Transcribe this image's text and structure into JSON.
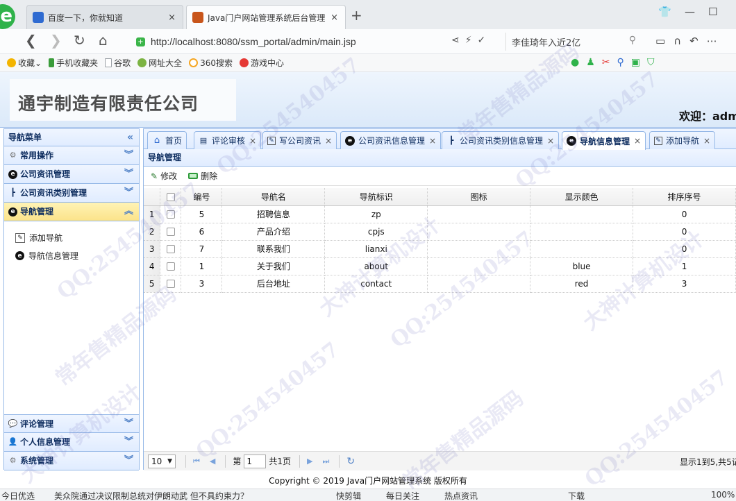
{
  "browser": {
    "tabs": [
      {
        "title": "百度一下，你就知道",
        "icon": "paw-icon",
        "color": "#2f6bd1"
      },
      {
        "title": "Java门户网站管理系统后台管理",
        "icon": "page-icon",
        "color": "#c8551b"
      }
    ],
    "tab_close": "×",
    "new_tab": "+",
    "url": "http://localhost:8080/ssm_portal/admin/main.jsp",
    "search_text": "李佳琦年入近2亿",
    "bookmarks": [
      {
        "label": "收藏",
        "icon": "star-icon",
        "color": "#f3b400"
      },
      {
        "label": "手机收藏夹",
        "icon": "phone-icon",
        "color": "#3a9c3a"
      },
      {
        "label": "谷歌",
        "icon": "doc-icon",
        "color": "#9aa0a6"
      },
      {
        "label": "网址大全",
        "icon": "globe-icon",
        "color": "#7cb342"
      },
      {
        "label": "360搜索",
        "icon": "search-360-icon",
        "color": "#f5a623"
      },
      {
        "label": "游戏中心",
        "icon": "game-icon",
        "color": "#e53935"
      }
    ]
  },
  "header": {
    "company": "通宇制造有限责任公司",
    "welcome": "欢迎：adm"
  },
  "sidebar": {
    "title": "导航菜单",
    "groups_top": [
      {
        "label": "常用操作",
        "icon": "gear-icon"
      },
      {
        "label": "公司资讯管理",
        "icon": "circle-e-icon"
      },
      {
        "label": "公司资讯类别管理",
        "icon": "tree-icon"
      },
      {
        "label": "导航管理",
        "icon": "circle-e-icon"
      }
    ],
    "sub_items": [
      {
        "label": "添加导航",
        "icon": "edit-icon"
      },
      {
        "label": "导航信息管理",
        "icon": "circle-e-icon"
      }
    ],
    "groups_bottom": [
      {
        "label": "评论管理",
        "icon": "comment-icon"
      },
      {
        "label": "个人信息管理",
        "icon": "user-icon"
      },
      {
        "label": "系统管理",
        "icon": "gear-icon"
      }
    ]
  },
  "content_tabs": [
    {
      "label": "首页",
      "icon": "home-icon"
    },
    {
      "label": "评论审核",
      "icon": "comment-icon"
    },
    {
      "label": "写公司资讯",
      "icon": "edit-icon"
    },
    {
      "label": "公司资讯信息管理",
      "icon": "circle-e-icon"
    },
    {
      "label": "公司资讯类别信息管理",
      "icon": "tree-icon"
    },
    {
      "label": "导航信息管理",
      "icon": "circle-e-icon",
      "active": true
    },
    {
      "label": "添加导航",
      "icon": "edit-icon"
    }
  ],
  "grid": {
    "title": "导航管理",
    "toolbar": {
      "edit": "修改",
      "delete": "删除"
    },
    "columns": [
      "编号",
      "导航名",
      "导航标识",
      "图标",
      "显示颜色",
      "排序序号"
    ],
    "rows": [
      {
        "num": "1",
        "id": "5",
        "name": "招聘信息",
        "key": "zp",
        "icon": "",
        "color": "",
        "order": "0"
      },
      {
        "num": "2",
        "id": "6",
        "name": "产品介绍",
        "key": "cpjs",
        "icon": "",
        "color": "",
        "order": "0"
      },
      {
        "num": "3",
        "id": "7",
        "name": "联系我们",
        "key": "lianxi",
        "icon": "",
        "color": "",
        "order": "0"
      },
      {
        "num": "4",
        "id": "1",
        "name": "关于我们",
        "key": "about",
        "icon": "",
        "color": "blue",
        "order": "1"
      },
      {
        "num": "5",
        "id": "3",
        "name": "后台地址",
        "key": "contact",
        "icon": "",
        "color": "red",
        "order": "3"
      }
    ],
    "pager": {
      "page_size": "10",
      "page_prefix": "第",
      "page_value": "1",
      "page_total": "共1页",
      "info": "显示1到5,共5记"
    }
  },
  "footer": "Copyright © 2019 Java门户网站管理系统 版权所有",
  "statusbar": {
    "left": "今日优选",
    "news": "美众院通过决议限制总统对伊朗动武 但不具约束力？",
    "items": [
      "快剪辑",
      "每日关注",
      "热点资讯"
    ],
    "download": "下载",
    "zoom": "100%"
  },
  "watermarks": [
    "QQ:254540457",
    "常年售精品源码",
    "大神计算机设计"
  ]
}
